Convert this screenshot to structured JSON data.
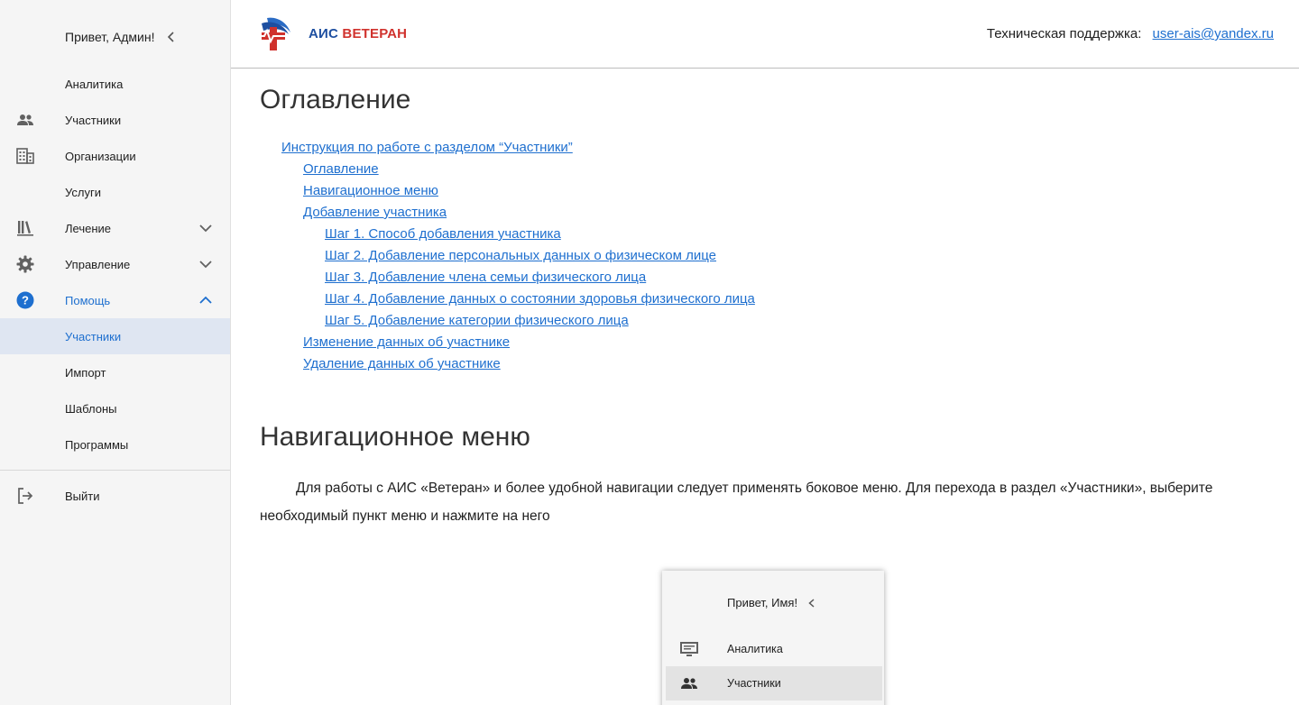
{
  "sidebar": {
    "greeting": "Привет, Админ!",
    "items": [
      {
        "label": "Аналитика",
        "icon": "none"
      },
      {
        "label": "Участники",
        "icon": "people-icon"
      },
      {
        "label": "Организации",
        "icon": "building-icon"
      },
      {
        "label": "Услуги",
        "icon": "none"
      },
      {
        "label": "Лечение",
        "icon": "library-icon",
        "expand": "chevron-down-icon"
      },
      {
        "label": "Управление",
        "icon": "gear-icon",
        "expand": "chevron-down-icon"
      },
      {
        "label": "Помощь",
        "icon": "help-icon",
        "expand": "chevron-up-icon"
      },
      {
        "label": "Участники",
        "selected": true
      },
      {
        "label": "Импорт"
      },
      {
        "label": "Шаблоны"
      },
      {
        "label": "Программы"
      }
    ],
    "logout": "Выйти"
  },
  "header": {
    "brand_part1": "АИС",
    "brand_part2": "ВЕТЕРАН",
    "support_label": "Техническая поддержка:",
    "support_email": "user-ais@yandex.ru"
  },
  "main": {
    "toc_title": "Оглавление",
    "toc": [
      {
        "text": "Инструкция по работе с разделом “Участники”",
        "level": 1
      },
      {
        "text": "Оглавление",
        "level": 2
      },
      {
        "text": "Навигационное меню",
        "level": 2
      },
      {
        "text": "Добавление участника",
        "level": 2
      },
      {
        "text": "Шаг 1. Способ добавления участника",
        "level": 3
      },
      {
        "text": "Шаг 2. Добавление персональных данных о физическом лице",
        "level": 3
      },
      {
        "text": "Шаг 3. Добавление члена семьи физического лица",
        "level": 3
      },
      {
        "text": "Шаг 4. Добавление данных о состоянии здоровья физического лица",
        "level": 3
      },
      {
        "text": "Шаг 5. Добавление категории физического лица",
        "level": 3
      },
      {
        "text": "Изменение данных об участнике",
        "level": 2
      },
      {
        "text": "Удаление данных об участнике",
        "level": 2
      }
    ],
    "nav_title": "Навигационное меню",
    "nav_paragraph": "Для работы с АИС «Ветеран» и более удобной навигации следует применять боковое меню. Для перехода в раздел «Участники», выберите необходимый пункт меню и нажмите на него",
    "screenshot": {
      "greeting": "Привет, Имя!",
      "items": [
        {
          "label": "Аналитика",
          "icon": "monitor-icon"
        },
        {
          "label": "Участники",
          "icon": "people-icon",
          "selected": true
        }
      ]
    }
  },
  "colors": {
    "accent": "#1e6fcf",
    "brand_blue": "#1e4fa0",
    "brand_red": "#d0322d",
    "selected_bg": "#dfe6f2"
  }
}
